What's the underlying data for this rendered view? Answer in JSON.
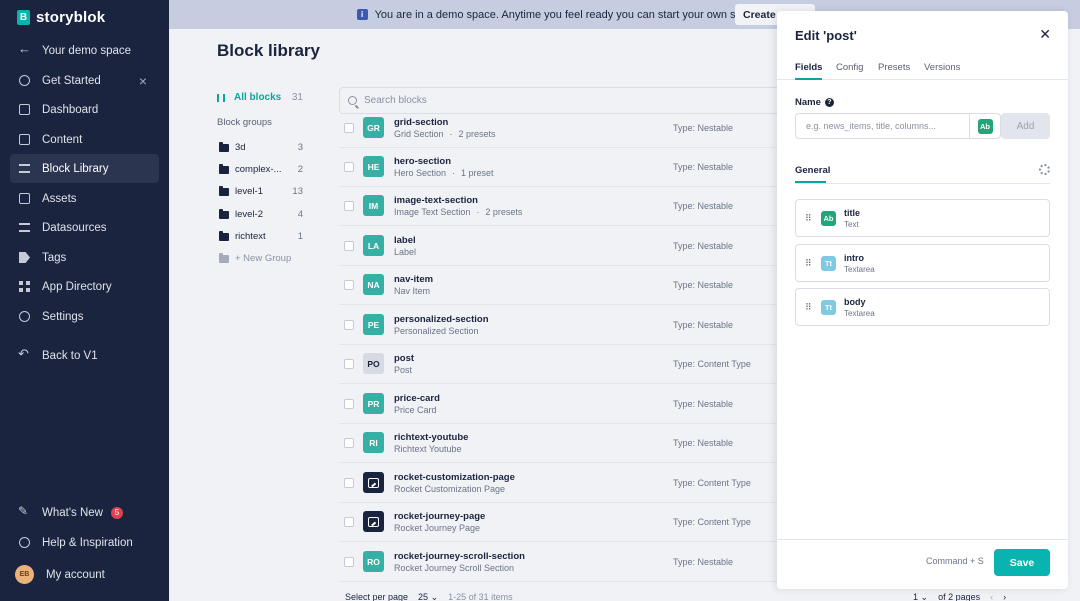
{
  "app": {
    "brand": "storyblok",
    "logo_letter": "B"
  },
  "sidebar": {
    "space": "Your demo space",
    "items": [
      {
        "label": "Get Started",
        "icon": "rocket-icon"
      },
      {
        "label": "Dashboard",
        "icon": "dashboard-icon"
      },
      {
        "label": "Content",
        "icon": "content-icon"
      },
      {
        "label": "Block Library",
        "icon": "block-library-icon"
      },
      {
        "label": "Assets",
        "icon": "assets-icon"
      },
      {
        "label": "Datasources",
        "icon": "datasources-icon"
      },
      {
        "label": "Tags",
        "icon": "tag-icon"
      },
      {
        "label": "App Directory",
        "icon": "apps-icon"
      },
      {
        "label": "Settings",
        "icon": "gear-icon"
      },
      {
        "label": "Back to V1",
        "icon": "back-icon"
      }
    ],
    "whats_new": "What's New",
    "whats_new_count": "5",
    "help": "Help & Inspiration",
    "account": "My account",
    "avatar_initials": "EB"
  },
  "banner": {
    "info_glyph": "i",
    "text": "You are in a demo space. Anytime you feel ready you can start your own space.",
    "button": "Create a"
  },
  "main": {
    "title": "Block library",
    "all_blocks_label": "All blocks",
    "all_blocks_count": "31",
    "groups_heading": "Block groups",
    "groups": [
      {
        "name": "3d",
        "count": "3"
      },
      {
        "name": "complex-...",
        "count": "2"
      },
      {
        "name": "level-1",
        "count": "13"
      },
      {
        "name": "level-2",
        "count": "4"
      },
      {
        "name": "richtext",
        "count": "1"
      }
    ],
    "new_group": "+ New Group",
    "search_placeholder": "Search blocks"
  },
  "blocks": [
    {
      "abbr": "GR",
      "name": "grid-section",
      "display": "Grid Section",
      "presets": "2 presets",
      "type": "Type: Nestable",
      "style": "teal"
    },
    {
      "abbr": "HE",
      "name": "hero-section",
      "display": "Hero Section",
      "presets": "1 preset",
      "type": "Type: Nestable",
      "style": "teal"
    },
    {
      "abbr": "IM",
      "name": "image-text-section",
      "display": "Image Text Section",
      "presets": "2 presets",
      "type": "Type: Nestable",
      "style": "teal"
    },
    {
      "abbr": "LA",
      "name": "label",
      "display": "Label",
      "presets": "",
      "type": "Type: Nestable",
      "style": "teal"
    },
    {
      "abbr": "NA",
      "name": "nav-item",
      "display": "Nav Item",
      "presets": "",
      "type": "Type: Nestable",
      "style": "teal"
    },
    {
      "abbr": "PE",
      "name": "personalized-section",
      "display": "Personalized Section",
      "presets": "",
      "type": "Type: Nestable",
      "style": "teal"
    },
    {
      "abbr": "PO",
      "name": "post",
      "display": "Post",
      "presets": "",
      "type": "Type: Content Type",
      "style": "grey"
    },
    {
      "abbr": "PR",
      "name": "price-card",
      "display": "Price Card",
      "presets": "",
      "type": "Type: Nestable",
      "style": "teal"
    },
    {
      "abbr": "RI",
      "name": "richtext-youtube",
      "display": "Richtext Youtube",
      "presets": "",
      "type": "Type: Nestable",
      "style": "teal"
    },
    {
      "abbr": "",
      "name": "rocket-customization-page",
      "display": "Rocket Customization Page",
      "presets": "",
      "type": "Type: Content Type",
      "style": "dark"
    },
    {
      "abbr": "",
      "name": "rocket-journey-page",
      "display": "Rocket Journey Page",
      "presets": "",
      "type": "Type: Content Type",
      "style": "dark"
    },
    {
      "abbr": "RO",
      "name": "rocket-journey-scroll-section",
      "display": "Rocket Journey Scroll Section",
      "presets": "",
      "type": "Type: Nestable",
      "style": "teal"
    }
  ],
  "pagination": {
    "per_page_label": "Select per page",
    "per_page_value": "25",
    "range": "1-25 of 31 items",
    "page": "1",
    "of_pages": "of 2 pages"
  },
  "panel": {
    "title": "Edit 'post'",
    "tabs": [
      "Fields",
      "Config",
      "Presets",
      "Versions"
    ],
    "name_label": "Name",
    "name_placeholder": "e.g. news_items, title, columns...",
    "type_icon": "Ab",
    "add_button": "Add",
    "general_tab": "General",
    "fields": [
      {
        "name": "title",
        "type": "Text",
        "icon": "Ab",
        "color": "#21a679"
      },
      {
        "name": "intro",
        "type": "Textarea",
        "icon": "Tt",
        "color": "#7fc9e3"
      },
      {
        "name": "body",
        "type": "Textarea",
        "icon": "Tt",
        "color": "#7fc9e3"
      }
    ],
    "shortcut": "Command + S",
    "save_button": "Save"
  },
  "colors": {
    "sidebar": "#1b243f",
    "accent": "#09b3af",
    "banner": "#c7cde0"
  }
}
